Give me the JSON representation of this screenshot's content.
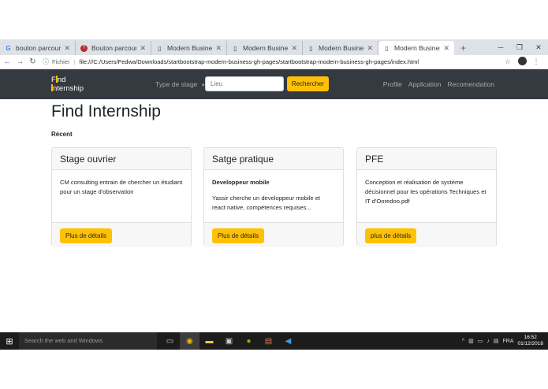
{
  "browser": {
    "tabs": [
      {
        "title": "bouton parcouri",
        "icon": "google-icon"
      },
      {
        "title": "Bouton parcouri",
        "icon": "quora-icon"
      },
      {
        "title": "Modern Business",
        "icon": "page-icon"
      },
      {
        "title": "Modern Business",
        "icon": "page-icon"
      },
      {
        "title": "Modern Business",
        "icon": "page-icon"
      },
      {
        "title": "Modern Business",
        "icon": "page-icon",
        "active": true
      }
    ],
    "address": {
      "scheme_label": "Fichier",
      "url": "file:///C:/Users/Fedwa/Downloads/startbootstrap-modern-business-gh-pages/startbootstrap-modern-business-gh-pages/index.html"
    }
  },
  "navbar": {
    "brand": {
      "letter1": "F",
      "line1_rest": "nd",
      "letter2": "I",
      "line2_rest": "nternship"
    },
    "dropdown_label": "Type de stage",
    "location_placeholder": "Lieu",
    "search_button": "Rechercher",
    "links": [
      "Profile",
      "Application",
      "Recomendation"
    ]
  },
  "main": {
    "title": "Find Internship",
    "section_label": "Récent",
    "cards": [
      {
        "title": "Stage ouvrier",
        "subtitle": "",
        "text": "CM consulting entrain de chercher un étudiant pour un stage d'observation",
        "button": "Plus de détails"
      },
      {
        "title": "Satge pratique",
        "subtitle": "Developpeur mobile",
        "text": "Yassir cherche un developpeur mobile et react native, compétences requises...",
        "button": "Plus de détails"
      },
      {
        "title": "PFE",
        "subtitle": "",
        "text": "Conception et réalisation de système décisionnel pour les opérations Techniques et IT d'Ooredoo.pdf",
        "button": "plus de détails"
      }
    ]
  },
  "taskbar": {
    "search_placeholder": "Search the web and Windows",
    "language": "FRA",
    "time": "16:52",
    "date": "01/12/2018"
  },
  "colors": {
    "accent": "#ffc107",
    "navbar": "#343a40"
  }
}
